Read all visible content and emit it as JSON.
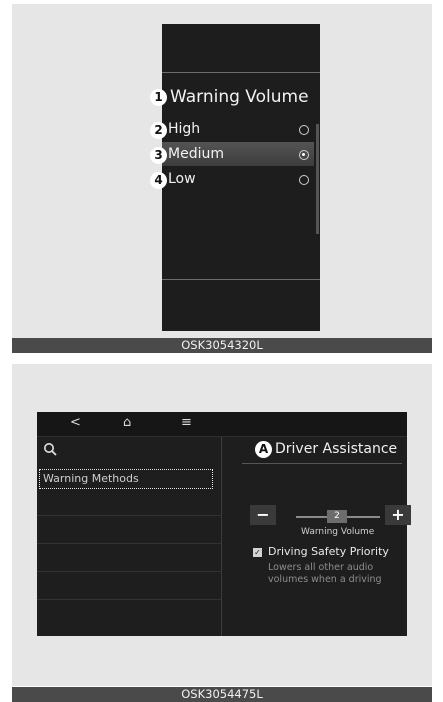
{
  "figure1": {
    "title": "Warning Volume",
    "title_marker": "1",
    "options": [
      {
        "marker": "2",
        "label": "High",
        "selected": false
      },
      {
        "marker": "3",
        "label": "Medium",
        "selected": true
      },
      {
        "marker": "4",
        "label": "Low",
        "selected": false
      }
    ],
    "caption": "OSK3054320L"
  },
  "figure2": {
    "nav": {
      "back": "<",
      "home": "⌂",
      "menu": "≡"
    },
    "search_icon": "search-icon",
    "left_menu": {
      "selected_item": "Warning Methods"
    },
    "panel": {
      "marker": "A",
      "title": "Driver Assistance",
      "minus_label": "−",
      "plus_label": "+",
      "slider_value": "2",
      "slider_label": "Warning Volume",
      "checkbox_label": "Driving Safety Priority",
      "checkbox_checked": true,
      "checkbox_mark": "✓",
      "checkbox_description": "Lowers all other audio volumes when a driving safety"
    },
    "caption": "OSK3054475L"
  },
  "colors": {
    "screen_bg": "#1d1d1d",
    "frame_bg": "#e6e6e6",
    "caption_bg": "#4a4a4a",
    "badge_bg": "#ffffff"
  }
}
